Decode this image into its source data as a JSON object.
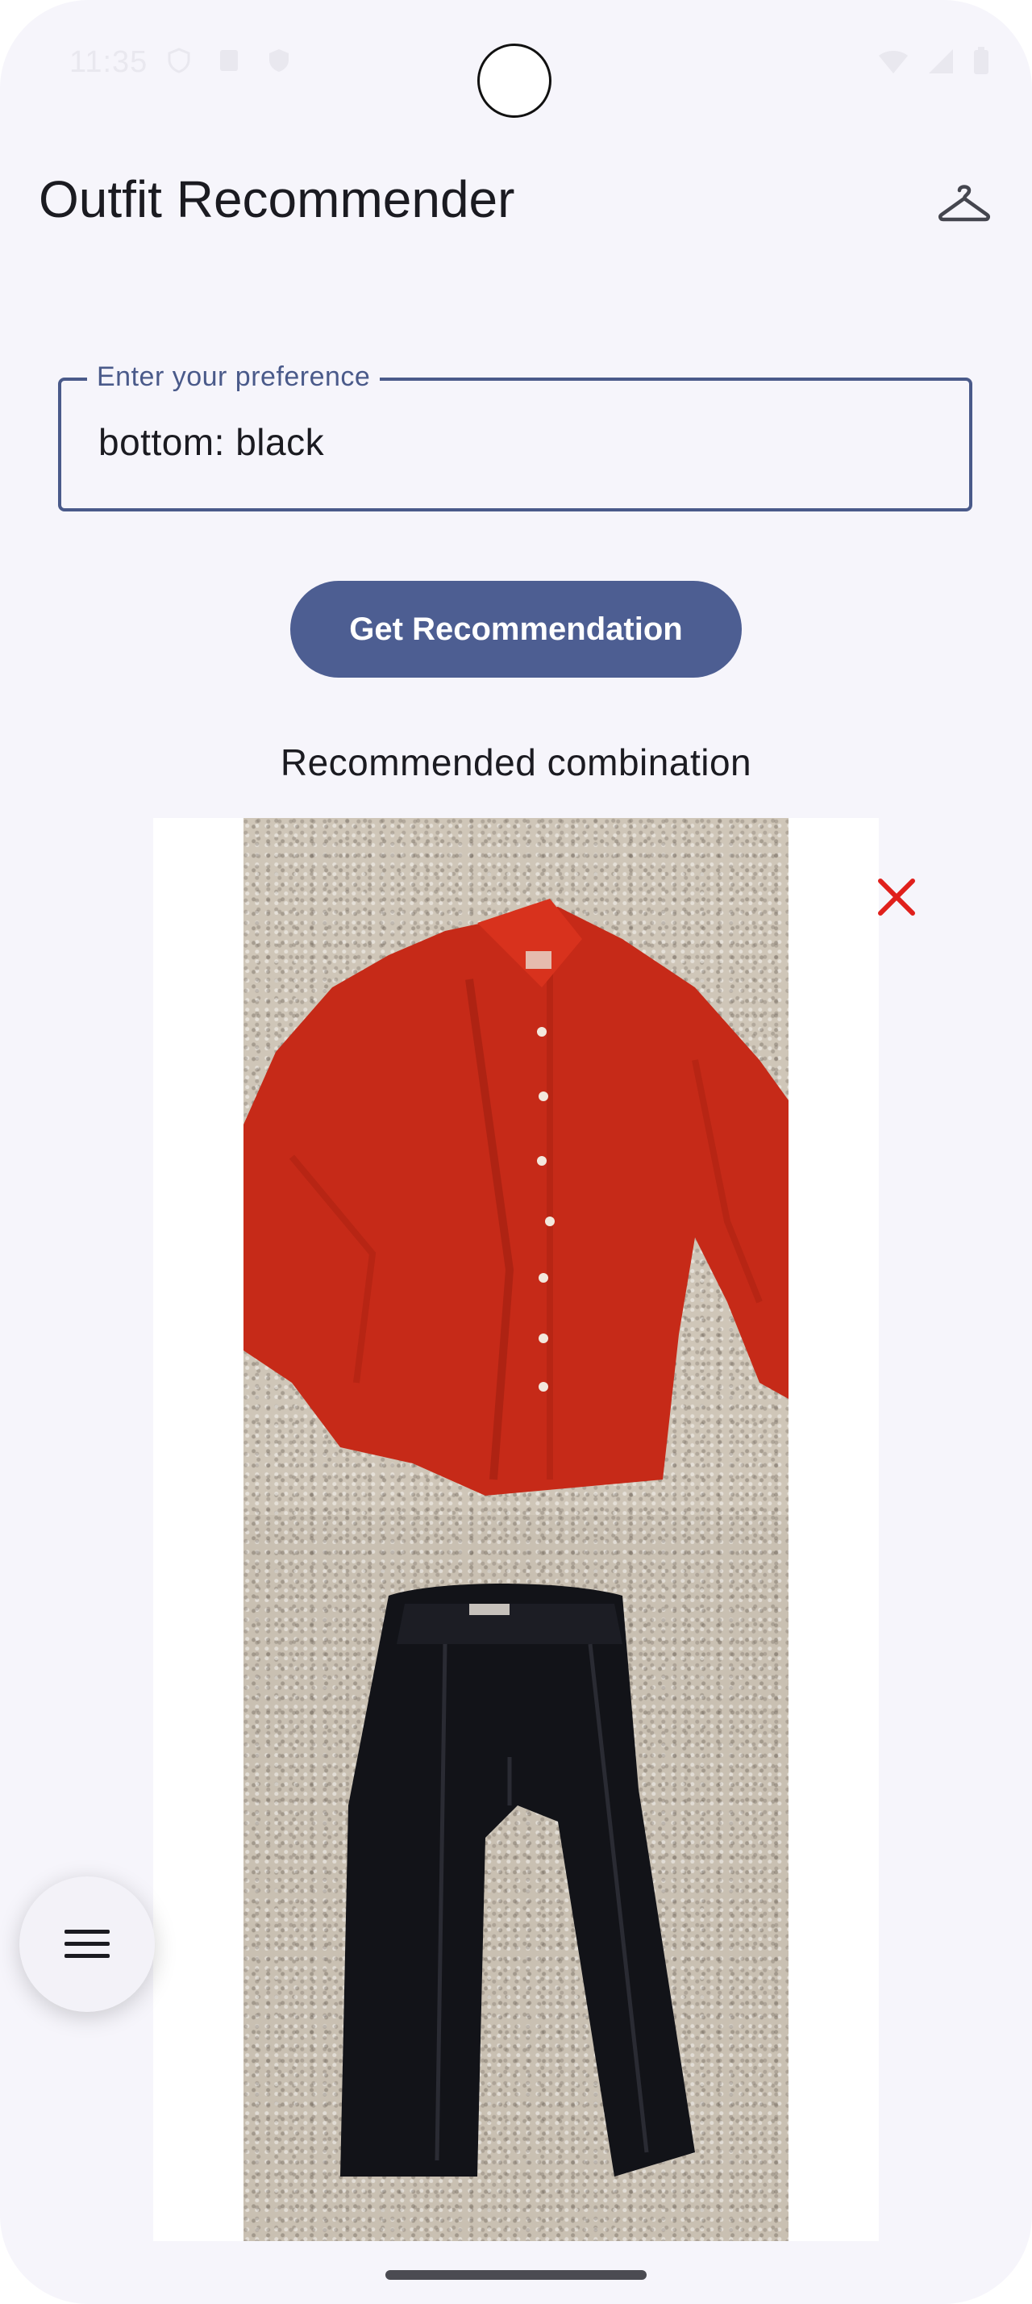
{
  "status_bar": {
    "time": "11:35",
    "icons": [
      "shield-icon",
      "sim-icon",
      "vpn-icon",
      "wifi-icon",
      "signal-icon",
      "battery-icon"
    ]
  },
  "app_bar": {
    "title": "Outfit Recommender",
    "action_icon": "hanger-icon"
  },
  "preference_field": {
    "label": "Enter your preference",
    "value": "bottom: black"
  },
  "recommend_button": {
    "label": "Get Recommendation"
  },
  "result": {
    "title": "Recommended combination",
    "close_icon": "close-icon",
    "items": [
      {
        "name": "top-photo",
        "description": "red shirt"
      },
      {
        "name": "bottom-photo",
        "description": "black pants"
      }
    ]
  },
  "fab": {
    "icon": "menu-icon"
  },
  "colors": {
    "primary": "#4d5e92",
    "background": "#f6f5fb",
    "close": "#e0201c"
  }
}
